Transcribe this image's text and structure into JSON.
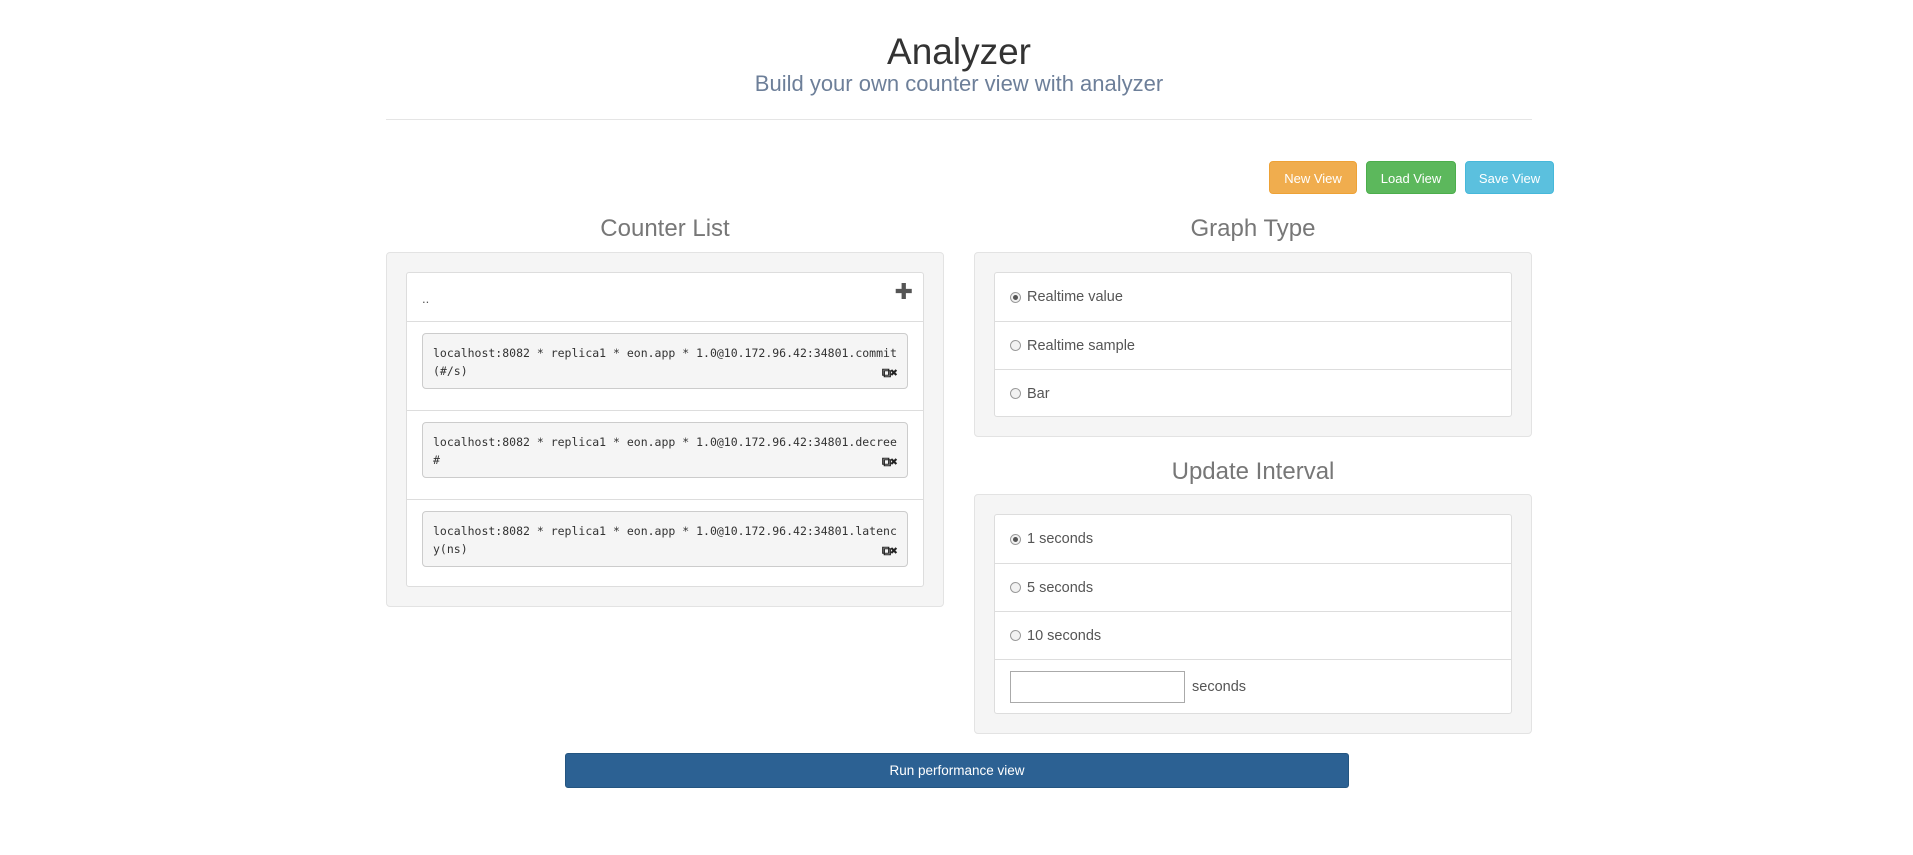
{
  "header": {
    "title": "Analyzer",
    "subtitle": "Build your own counter view with analyzer"
  },
  "toolbar": {
    "new_view": "New View",
    "load_view": "Load View",
    "save_view": "Save View",
    "colors": {
      "new": "#f0ad4e",
      "load": "#5cb85c",
      "save": "#5bc0de"
    }
  },
  "counter_list": {
    "title": "Counter List",
    "path": "..",
    "add_icon": "plus-icon",
    "items": [
      {
        "text": "localhost:8082 * replica1 * eon.app * 1.0@10.172.96.42:34801.commit(#/s)"
      },
      {
        "text": "localhost:8082 * replica1 * eon.app * 1.0@10.172.96.42:34801.decree#"
      },
      {
        "text": "localhost:8082 * replica1 * eon.app * 1.0@10.172.96.42:34801.latency(ns)"
      }
    ],
    "item_icons": [
      "copy-icon",
      "close-icon"
    ]
  },
  "graph_type": {
    "title": "Graph Type",
    "options": [
      "Realtime value",
      "Realtime sample",
      "Bar"
    ],
    "selected": "Realtime value"
  },
  "update_interval": {
    "title": "Update Interval",
    "options": [
      "1 seconds",
      "5 seconds",
      "10 seconds"
    ],
    "selected": "1 seconds",
    "custom_value": "",
    "custom_unit": "seconds"
  },
  "run_button": {
    "label": "Run performance view",
    "color": "#2c6193"
  }
}
